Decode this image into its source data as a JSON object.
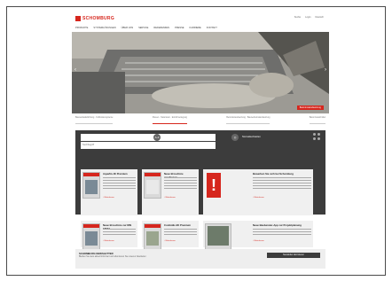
{
  "header": {
    "logo_text": "SCHOMBURG",
    "util_links": [
      "Suche",
      "Login",
      "Deutsch"
    ],
    "nav": [
      "Produkte",
      "Systemlösungen",
      "Über uns",
      "Service",
      "Referenzen",
      "Presse",
      "Karriere",
      "Kontakt"
    ]
  },
  "hero": {
    "button_label": "Betoninstandsetzung"
  },
  "tabs": [
    "Bauwerksabdichtung · Fußbodensysteme",
    "Fliesen · Naturstein · Estrichverlegung",
    "Betoninstandsetzung · Bauwerksinstandsetzung",
    "Betonzusatzmittel"
  ],
  "toolbar": {
    "search_placeholder": "Suchbegriff",
    "system_label": "Systemlösungen",
    "norm_label": "Normalsuchseiten"
  },
  "cards": [
    {
      "title": "Aquafin-1K Premium",
      "more": "› Weiterlesen",
      "kind": "product"
    },
    {
      "title": "Neue Broschüre erschienen",
      "more": "› Weiterlesen",
      "kind": "product"
    },
    {
      "title": "Bewerben Sie sich bei Schomburg",
      "more": "› Weiterlesen",
      "kind": "alert"
    },
    {
      "title": "Neue Broschüre zur DIN 18533",
      "more": "› Weiterlesen",
      "kind": "product"
    },
    {
      "title": "Combidic-2K Premium",
      "more": "› Weiterlesen",
      "kind": "product"
    },
    {
      "title": "Neue Bauberater-App zur Projektplanung",
      "more": "› Weiterlesen",
      "kind": "product"
    }
  ],
  "newsletter": {
    "title": "SCHOMBURG NEWSLETTER",
    "subtitle": "Bleiben Sie stets aktuell informiert und abonnieren Sie unseren Newsletter",
    "button_label": "Newsletter abonnieren"
  },
  "colors": {
    "brand_red": "#d6261d",
    "dark_bar": "#3c3c3c"
  }
}
